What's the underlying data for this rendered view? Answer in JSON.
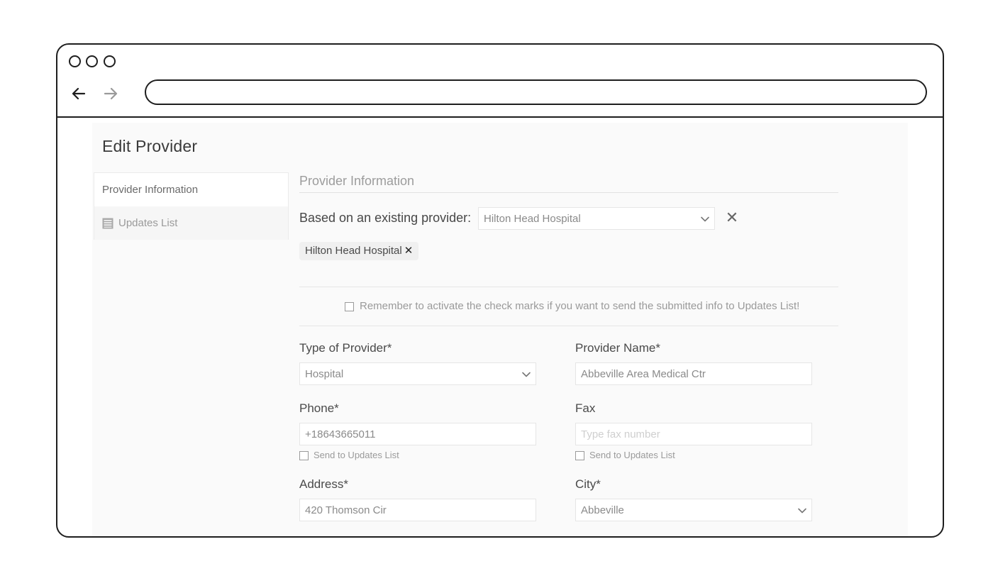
{
  "page": {
    "title": "Edit Provider"
  },
  "sidebar": {
    "items": [
      {
        "label": "Provider Information",
        "icon": "none",
        "active": true
      },
      {
        "label": "Updates List",
        "icon": "list-icon",
        "active": false
      }
    ]
  },
  "section": {
    "title": "Provider Information"
  },
  "based_on": {
    "label": "Based on an existing provider:",
    "selected": "Hilton Head Hospital",
    "tag": "Hilton Head Hospital",
    "tag_remove": "✕",
    "clear": "✕"
  },
  "reminder": {
    "text": "Remember to activate the check marks if you want to send the submitted info to Updates List!"
  },
  "form": {
    "type_of_provider": {
      "label": "Type of Provider*",
      "value": "Hospital"
    },
    "provider_name": {
      "label": "Provider Name*",
      "value": "Abbeville Area Medical Ctr"
    },
    "phone": {
      "label": "Phone*",
      "value": "+18643665011",
      "send_label": "Send to Updates List"
    },
    "fax": {
      "label": "Fax",
      "placeholder": "Type fax number",
      "send_label": "Send to Updates List"
    },
    "address": {
      "label": "Address*",
      "value": "420 Thomson Cir"
    },
    "city": {
      "label": "City*",
      "value": "Abbeville"
    }
  }
}
